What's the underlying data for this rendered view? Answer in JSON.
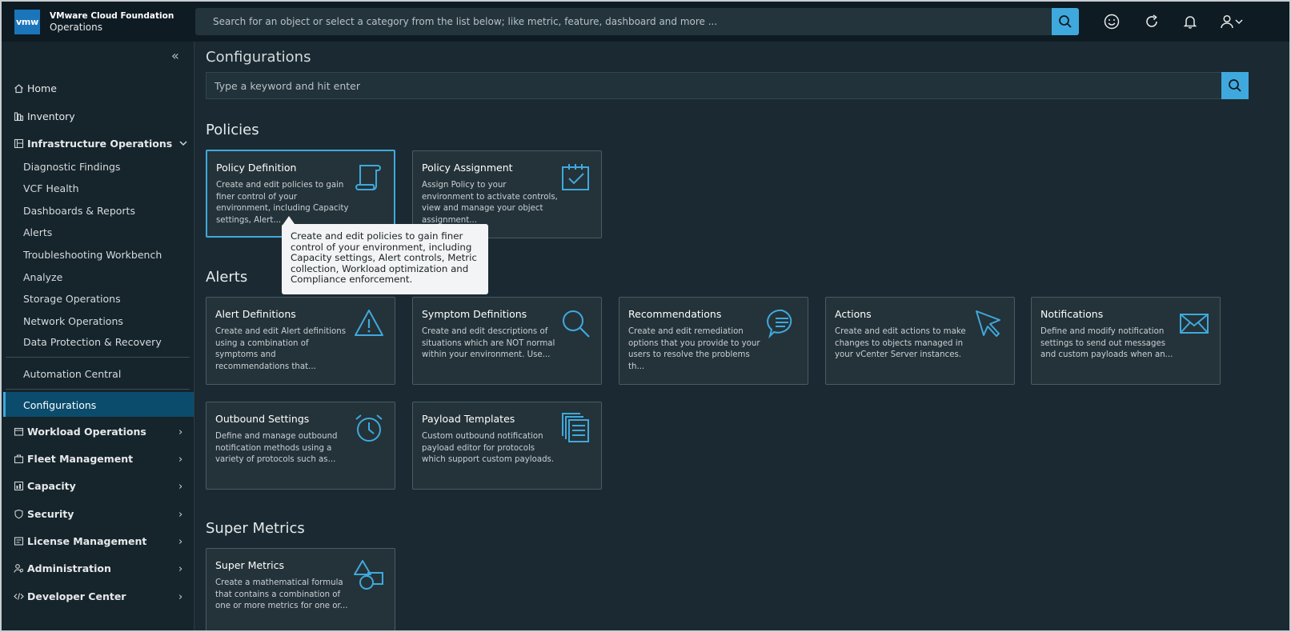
{
  "header": {
    "logo": "vmw",
    "brand_line1": "VMware Cloud Foundation",
    "brand_line2": "Operations",
    "search_placeholder": "Search for an object or select a category from the list below; like metric, feature, dashboard and more ..."
  },
  "sidebar": {
    "top_items": [
      {
        "label": "Home",
        "icon": "home-icon"
      },
      {
        "label": "Inventory",
        "icon": "inventory-icon"
      },
      {
        "label": "Infrastructure Operations",
        "icon": "infrastructure-icon"
      }
    ],
    "infra_sub": [
      "Diagnostic Findings",
      "VCF Health",
      "Dashboards & Reports",
      "Alerts",
      "Troubleshooting Workbench",
      "Analyze",
      "Storage Operations",
      "Network Operations",
      "Data Protection & Recovery"
    ],
    "automation": "Automation Central",
    "configurations": "Configurations",
    "groups": [
      {
        "label": "Workload Operations",
        "icon": "workload-icon"
      },
      {
        "label": "Fleet Management",
        "icon": "fleet-icon"
      },
      {
        "label": "Capacity",
        "icon": "capacity-icon"
      },
      {
        "label": "Security",
        "icon": "shield-icon"
      },
      {
        "label": "License Management",
        "icon": "license-icon"
      },
      {
        "label": "Administration",
        "icon": "admin-icon"
      },
      {
        "label": "Developer Center",
        "icon": "code-icon"
      }
    ]
  },
  "main": {
    "title": "Configurations",
    "search_placeholder": "Type a keyword and hit enter",
    "sections": {
      "policies": "Policies",
      "alerts": "Alerts",
      "super_metrics": "Super Metrics"
    },
    "cards": {
      "policy_definition": {
        "title": "Policy Definition",
        "desc": "Create and edit policies to gain finer control of your environment, including Capacity settings, Alert..."
      },
      "policy_assignment": {
        "title": "Policy Assignment",
        "desc": "Assign Policy to your environment to activate controls, view and manage your object assignment..."
      },
      "alert_definitions": {
        "title": "Alert Definitions",
        "desc": "Create and edit Alert definitions using a combination of symptoms and recommendations that..."
      },
      "symptom_definitions": {
        "title": "Symptom Definitions",
        "desc": "Create and edit descriptions of situations which are NOT normal within your environment. Use..."
      },
      "recommendations": {
        "title": "Recommendations",
        "desc": "Create and edit remediation options that you provide to your users to resolve the problems th..."
      },
      "actions": {
        "title": "Actions",
        "desc": "Create and edit actions to make changes to objects managed in your vCenter Server instances."
      },
      "notifications": {
        "title": "Notifications",
        "desc": "Define and modify notification settings to send out messages and custom payloads when an..."
      },
      "outbound_settings": {
        "title": "Outbound Settings",
        "desc": "Define and manage outbound notification methods using a variety of protocols such as..."
      },
      "payload_templates": {
        "title": "Payload Templates",
        "desc": "Custom outbound notification payload editor for protocols which support custom payloads."
      },
      "super_metrics": {
        "title": "Super Metrics",
        "desc": "Create a mathematical formula that contains a combination of one or more metrics for one or..."
      }
    },
    "tooltip": "Create and edit policies to gain finer control of your environment, including Capacity settings, Alert controls, Metric collection, Workload optimization and Compliance enforcement."
  },
  "colors": {
    "accent": "#3fa9dd",
    "header_bg": "#0e1b22",
    "main_bg": "#1b2a32",
    "card_bg": "#243339",
    "active_nav": "#0b4c6d"
  }
}
